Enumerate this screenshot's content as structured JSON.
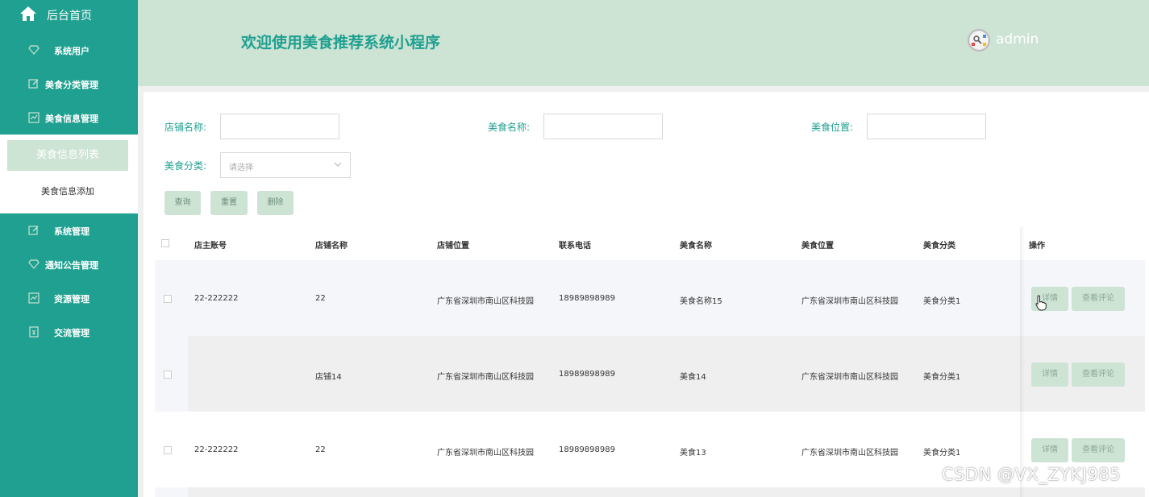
{
  "sidebar": {
    "home_label": "后台首页",
    "items": [
      {
        "label": "系统用户",
        "icon": "diamond-icon"
      },
      {
        "label": "美食分类管理",
        "icon": "edit-icon"
      },
      {
        "label": "美食信息管理",
        "icon": "chart-icon"
      },
      {
        "label": "系统管理",
        "icon": "edit-icon"
      },
      {
        "label": "通知公告管理",
        "icon": "diamond-icon"
      },
      {
        "label": "资源管理",
        "icon": "chart-icon"
      },
      {
        "label": "交流管理",
        "icon": "shield-icon"
      }
    ],
    "sub_items": [
      {
        "label": "美食信息列表",
        "active": true
      },
      {
        "label": "美食信息添加",
        "active": false
      }
    ]
  },
  "header": {
    "title": "欢迎使用美食推荐系统小程序",
    "username": "admin"
  },
  "search": {
    "shop_name_label": "店铺名称:",
    "food_name_label": "美食名称:",
    "food_location_label": "美食位置:",
    "food_category_label": "美食分类:",
    "category_placeholder": "请选择",
    "query_button": "查询",
    "reset_button": "重置",
    "delete_button": "删除"
  },
  "table": {
    "columns": [
      "店主账号",
      "店铺名称",
      "店铺位置",
      "联系电话",
      "美食名称",
      "美食位置",
      "美食分类",
      "操作"
    ],
    "rows": [
      {
        "owner": "22-222222",
        "shop": "22",
        "shop_location": "广东省深圳市南山区科技园",
        "phone": "18989898989",
        "food": "美食名称15",
        "food_location": "广东省深圳市南山区科技园",
        "category": "美食分类1"
      },
      {
        "owner": "",
        "shop": "店铺14",
        "shop_location": "广东省深圳市南山区科技园",
        "phone": "18989898989",
        "food": "美食14",
        "food_location": "广东省深圳市南山区科技园",
        "category": "美食分类1"
      },
      {
        "owner": "22-222222",
        "shop": "22",
        "shop_location": "广东省深圳市南山区科技园",
        "phone": "18989898989",
        "food": "美食13",
        "food_location": "广东省深圳市南山区科技园",
        "category": "美食分类1"
      }
    ],
    "detail_button": "详情",
    "review_button": "查看评论"
  },
  "watermark": "CSDN @VX_ZYKJ985",
  "colors": {
    "sidebar": "#1fa090",
    "header": "#cde3d4",
    "accent": "#1fa090"
  }
}
